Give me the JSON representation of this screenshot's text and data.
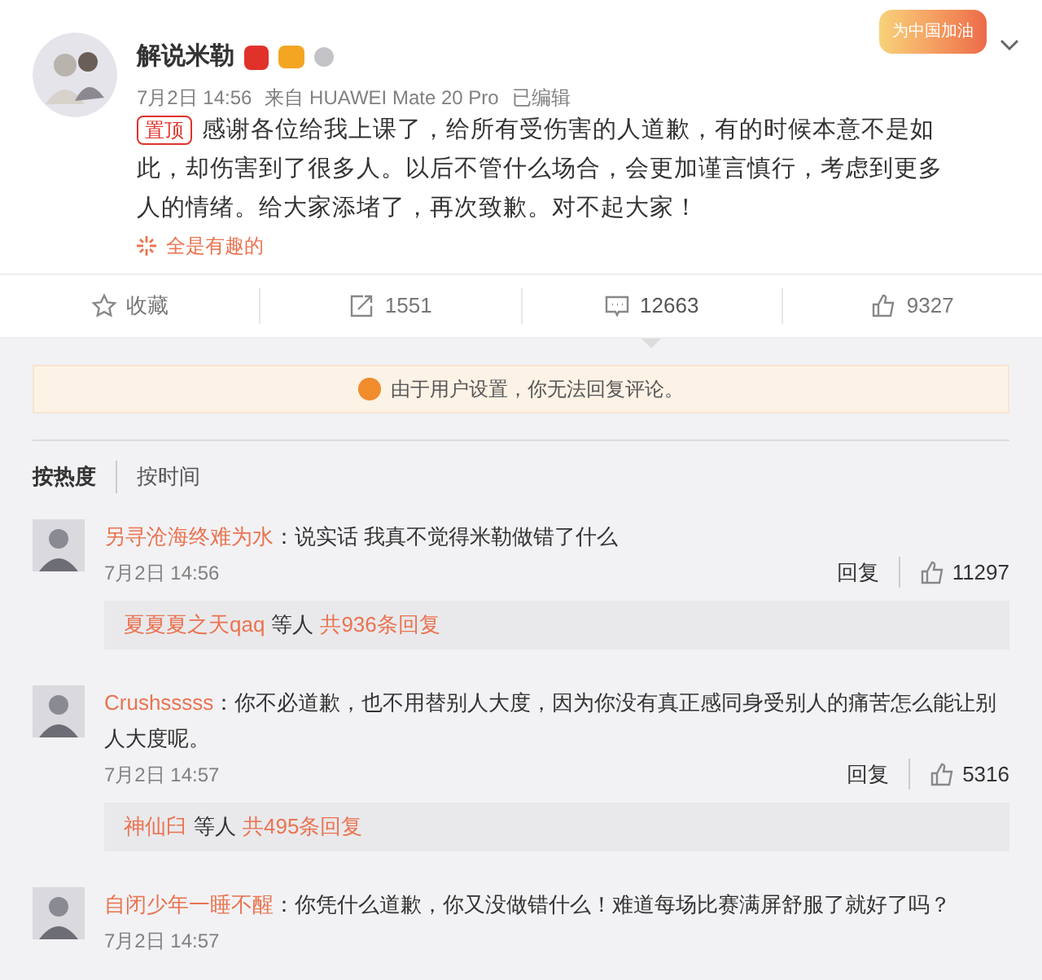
{
  "post": {
    "author": "解说米勒",
    "header_badge": "为中国加油",
    "date": "7月2日 14:56",
    "source": "来自 HUAWEI Mate 20 Pro",
    "edited": "已编辑",
    "pinned": "置顶",
    "body": "感谢各位给我上课了，给所有受伤害的人道歉，有的时候本意不是如此，却伤害到了很多人。以后不管什么场合，会更加谨言慎行，考虑到更多人的情绪。给大家添堵了，再次致歉。对不起大家！",
    "topic": "全是有趣的"
  },
  "actions": [
    {
      "kind": "favorite",
      "label": "收藏",
      "selected": false
    },
    {
      "kind": "repost",
      "label": "1551",
      "selected": false
    },
    {
      "kind": "comment",
      "label": "12663",
      "selected": true
    },
    {
      "kind": "like",
      "label": "9327",
      "selected": false
    }
  ],
  "notice": "由于用户设置，你无法回复评论。",
  "sort_tabs": [
    {
      "label": "按热度",
      "selected": true
    },
    {
      "label": "按时间",
      "selected": false
    }
  ],
  "comments": [
    {
      "user": "另寻沧海终难为水",
      "colon": "：",
      "text": "说实话 我真不觉得米勒做错了什么",
      "time": "7月2日 14:56",
      "reply": "回复",
      "likes": "11297",
      "replies": {
        "users": "夏夏夏之天qaq",
        "middle": "等人",
        "total": "共936条回复"
      }
    },
    {
      "user": "Crushsssss",
      "colon": "：",
      "text": "你不必道歉，也不用替别人大度，因为你没有真正感同身受别人的痛苦怎么能让别人大度呢。",
      "time": "7月2日 14:57",
      "reply": "回复",
      "likes": "5316",
      "replies": {
        "users": "神仙臼",
        "middle": "等人",
        "total": "共495条回复"
      }
    },
    {
      "user": "自闭少年一睡不醒",
      "colon": "：",
      "text": "你凭什么道歉，你又没做错什么！难道每场比赛满屏舒服了就好了吗？",
      "time": "7月2日 14:57"
    }
  ]
}
